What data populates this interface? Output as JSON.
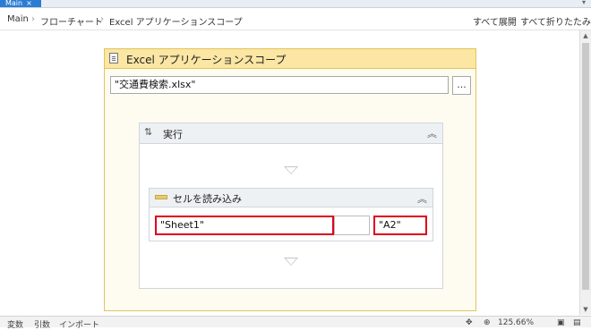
{
  "tab": {
    "label": "Main",
    "close": "×",
    "dropdown": "▾"
  },
  "breadcrumb": {
    "items": [
      "Main",
      "フローチャート",
      "Excel アプリケーションスコープ"
    ],
    "separator": "›"
  },
  "header_actions": {
    "expand_all": "すべて展開",
    "collapse_all": "すべて折りたたみ"
  },
  "scope": {
    "title": "Excel アプリケーションスコープ",
    "icon": "document-icon",
    "path_value": "\"交通費検索.xlsx\"",
    "browse_label": "..."
  },
  "sequence": {
    "title": "実行",
    "icon": "sequence-icon",
    "collapse_glyph": "︽"
  },
  "activity": {
    "title": "セルを読み込み",
    "icon": "excel-read-cell-icon",
    "collapse_glyph": "︽",
    "sheet_value": "\"Sheet1\"",
    "cell_value": "\"A2\""
  },
  "statusbar": {
    "variables": "変数",
    "arguments": "引数",
    "imports": "インポート",
    "zoom": "125.66%"
  },
  "colors": {
    "tab": "#2b7dd3",
    "highlight": "#e0001b",
    "scope_header": "#fbe6a3",
    "scope_border": "#e2c45a"
  }
}
